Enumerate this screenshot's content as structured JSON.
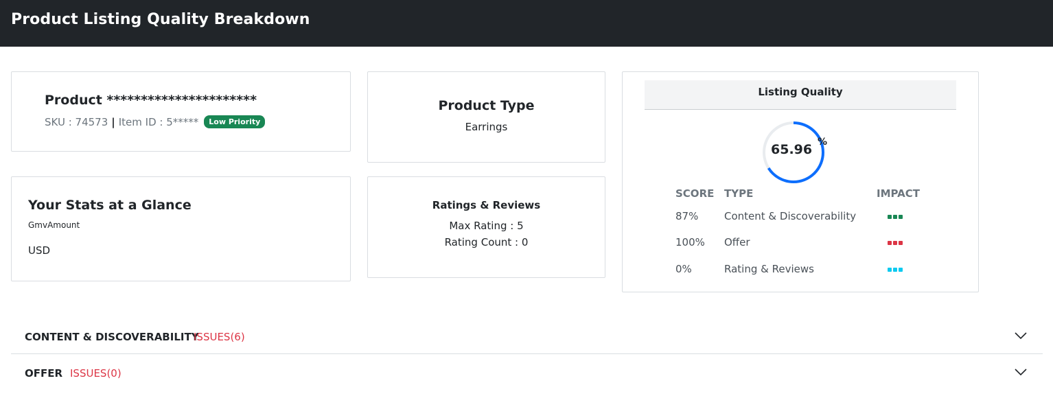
{
  "header": {
    "title": "Product Listing Quality Breakdown"
  },
  "product": {
    "name": "Product **********************",
    "sku_text": "SKU : 74573",
    "separator": "|",
    "item_id_text": "Item ID : 5*****",
    "priority_badge": "Low Priority"
  },
  "product_type": {
    "heading": "Product Type",
    "value": "Earrings"
  },
  "stats": {
    "heading": "Your Stats at a Glance",
    "gmv_label": "GmvAmount",
    "currency": "USD"
  },
  "ratings": {
    "heading": "Ratings & Reviews",
    "max_rating": "Max Rating : 5",
    "rating_count": "Rating Count : 0"
  },
  "listing_quality": {
    "heading": "Listing Quality",
    "score_value": "65.96",
    "score_unit": "%",
    "score_fraction": 0.6596,
    "columns": {
      "score": "SCORE",
      "type": "TYPE",
      "impact": "IMPACT"
    },
    "rows": [
      {
        "score": "87%",
        "type": "Content & Discoverability",
        "impact_color": "#198754"
      },
      {
        "score": "100%",
        "type": "Offer",
        "impact_color": "#dc3545"
      },
      {
        "score": "0%",
        "type": "Rating & Reviews",
        "impact_color": "#0dcaf0"
      }
    ]
  },
  "accordions": [
    {
      "title": "CONTENT & DISCOVERABILITY",
      "issues": "ISSUES(6)",
      "icon": "chevron-down-icon"
    },
    {
      "title": "OFFER",
      "issues": "ISSUES(0)",
      "icon": "chevron-down-icon"
    }
  ],
  "colors": {
    "header_bg": "#212529",
    "accent_blue": "#0d6efd",
    "issue_red": "#dc3545",
    "badge_green": "#198754"
  }
}
